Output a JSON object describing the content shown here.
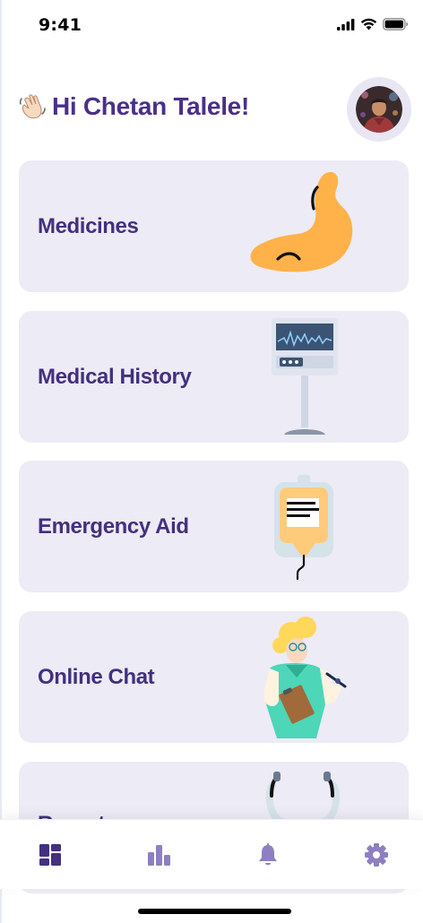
{
  "status_bar": {
    "time": "9:41"
  },
  "greeting": {
    "text": "Hi Chetan Talele!",
    "emoji": "waving-hand-icon"
  },
  "profile": {
    "avatar": "user-avatar"
  },
  "cards": [
    {
      "label": "Medicines",
      "icon": "stomach-illustration"
    },
    {
      "label": "Medical History",
      "icon": "monitor-stand-illustration"
    },
    {
      "label": "Emergency Aid",
      "icon": "iv-bag-illustration"
    },
    {
      "label": "Online Chat",
      "icon": "doctor-illustration"
    },
    {
      "label": "Reports",
      "icon": "stethoscope-illustration"
    }
  ],
  "bottom_nav": {
    "items": [
      {
        "icon": "dashboard-icon",
        "active": true
      },
      {
        "icon": "bar-chart-icon",
        "active": false
      },
      {
        "icon": "bell-icon",
        "active": false
      },
      {
        "icon": "settings-gear-icon",
        "active": false
      }
    ]
  },
  "colors": {
    "primary": "#43307f",
    "card_bg": "#edebf5",
    "inactive_icon": "#8d7fc2",
    "accent_orange": "#ffb14a",
    "accent_teal": "#4dd6b8"
  }
}
